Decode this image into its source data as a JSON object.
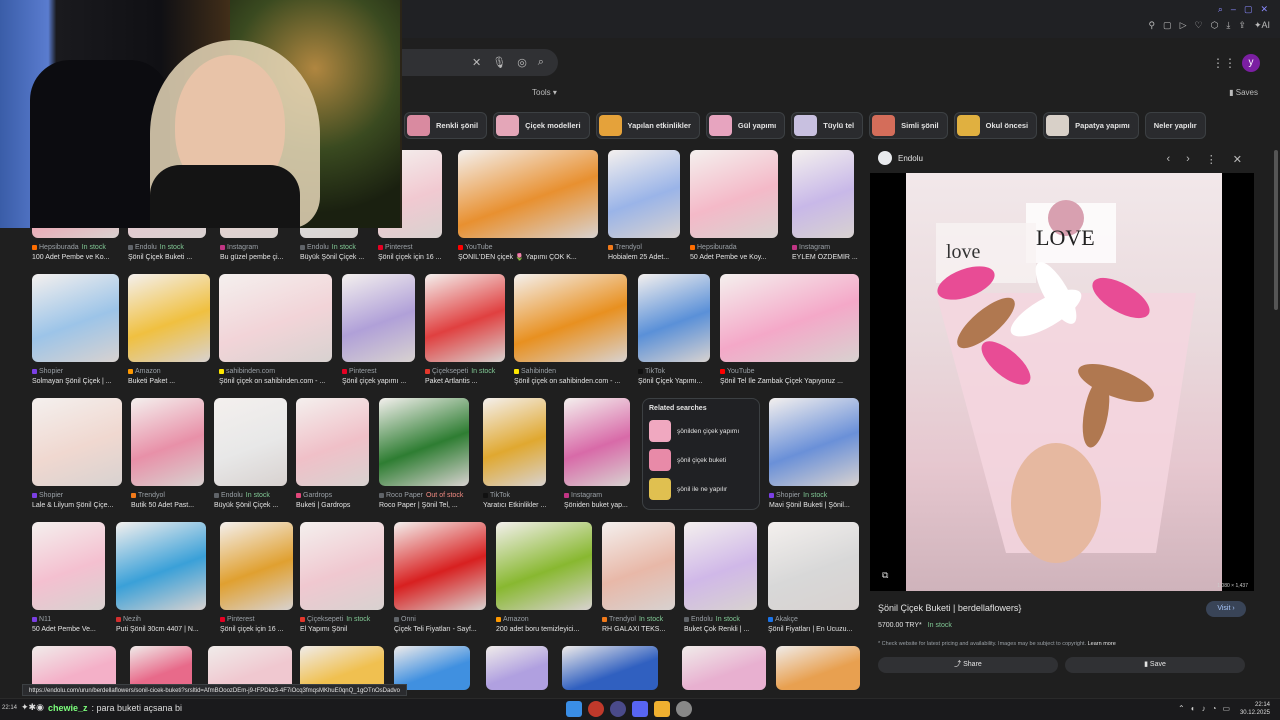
{
  "search": {
    "tools_label": "Tools",
    "saves_label": "Saves",
    "profile_initial": "y"
  },
  "chips": [
    {
      "label": "Renkli şönil",
      "color": "#d98aa0"
    },
    {
      "label": "Çiçek modelleri",
      "color": "#e4a6b8"
    },
    {
      "label": "Yapılan etkinlikler",
      "color": "#e5a23a"
    },
    {
      "label": "Gül yapımı",
      "color": "#e7a4bf"
    },
    {
      "label": "Tüylü tel",
      "color": "#c8c0e0"
    },
    {
      "label": "Simli şönil",
      "color": "#d46d5a"
    },
    {
      "label": "Okul öncesi",
      "color": "#e0b040"
    },
    {
      "label": "Papatya yapımı",
      "color": "#d8d0c8"
    },
    {
      "label": "Neler yapılır",
      "color": ""
    }
  ],
  "results": [
    {
      "src": "Hepsiburada",
      "stock": "In stock",
      "title": "100 Adet Pembe ve Ko...",
      "color": "#f0a0b0",
      "dot": "#ff6d00"
    },
    {
      "src": "Endolu",
      "stock": "In stock",
      "title": "Şönil Çiçek Buketi ...",
      "color": "#e6c7cf",
      "dot": "#5f6368"
    },
    {
      "src": "Instagram",
      "stock": "",
      "title": "Bu güzel pembe çi...",
      "color": "#e9d2cf",
      "dot": "#c13584"
    },
    {
      "src": "Endolu",
      "stock": "In stock",
      "title": "Büyük Şönil Çiçek ...",
      "color": "#ddd",
      "dot": "#5f6368"
    },
    {
      "src": "Pinterest",
      "stock": "",
      "title": "Şönil çiçek için 16 ...",
      "color": "#f1c9d1",
      "dot": "#e60023"
    },
    {
      "src": "YouTube",
      "stock": "",
      "title": "ŞÖNİL'DEN çiçek 🌷 Yapımı ÇOK K...",
      "color": "#e89030",
      "dot": "#ff0000"
    },
    {
      "src": "Trendyol",
      "stock": "",
      "title": "Hobialem 25 Adet...",
      "color": "#9ab4e8",
      "dot": "#f27a1a"
    },
    {
      "src": "Hepsiburada",
      "stock": "",
      "title": "50 Adet Pembe ve Koy...",
      "color": "#f4b9c8",
      "dot": "#ff6d00"
    },
    {
      "src": "Instagram",
      "stock": "",
      "title": "EYLEM ÖZDEMİR ...",
      "color": "#c8b8e8",
      "dot": "#c13584"
    },
    {
      "src": "Shopier",
      "stock": "",
      "title": "Solmayan Şönil Çiçek | ...",
      "color": "#9cc4e8",
      "dot": "#7b3fe4"
    },
    {
      "src": "Amazon",
      "stock": "",
      "title": "Buketi Paket ...",
      "color": "#f0c040",
      "dot": "#ff9900"
    },
    {
      "src": "sahibinden.com",
      "stock": "",
      "title": "Şönil çiçek on sahibinden.com - ...",
      "color": "#f2d4d8",
      "dot": "#ffe800"
    },
    {
      "src": "Pinterest",
      "stock": "",
      "title": "Şönil çiçek yapımı ...",
      "color": "#b0a0d8",
      "dot": "#e60023"
    },
    {
      "src": "Çiçeksepeti",
      "stock": "In stock",
      "title": "Paket Artlantis ...",
      "color": "#e04040",
      "dot": "#e4372b"
    },
    {
      "src": "Sahibinden",
      "stock": "",
      "title": "Şönil çiçek on sahibinden.com - ...",
      "color": "#e89020",
      "dot": "#ffe800"
    },
    {
      "src": "TikTok",
      "stock": "",
      "title": "Şönil Çiçek Yapımı...",
      "color": "#5a90d8",
      "dot": "#111"
    },
    {
      "src": "YouTube",
      "stock": "",
      "title": "Şönil Tel İle Zambak Çiçek Yapıyoruz ...",
      "color": "#f4a8c8",
      "dot": "#ff0000"
    },
    {
      "src": "Shopier",
      "stock": "",
      "title": "Lale & Lilyum Şönil Çiçe...",
      "color": "#f0d8d0",
      "dot": "#7b3fe4"
    },
    {
      "src": "Trendyol",
      "stock": "",
      "title": "Butik 50 Adet Past...",
      "color": "#e890a8",
      "dot": "#f27a1a"
    },
    {
      "src": "Endolu",
      "stock": "In stock",
      "title": "Büyük Şönil Çiçek ...",
      "color": "#e8e8e8",
      "dot": "#5f6368"
    },
    {
      "src": "Gardrops",
      "stock": "",
      "title": "Buketi | Gardrops",
      "color": "#f0c0c8",
      "dot": "#e2477b"
    },
    {
      "src": "Roco Paper",
      "stock": "Out of stock",
      "title": "Roco Paper | Şönil Tel, ...",
      "color": "#2e7d32",
      "dot": "#5f6368"
    },
    {
      "src": "TikTok",
      "stock": "",
      "title": "Yaratıcı Etkinlikler ...",
      "color": "#e0a830",
      "dot": "#111"
    },
    {
      "src": "Instagram",
      "stock": "",
      "title": "Şöniden buket yap...",
      "color": "#d86aa8",
      "dot": "#c13584"
    },
    {
      "src": "Shopier",
      "stock": "In stock",
      "title": "Mavi Şönil Buketi | Şönil...",
      "color": "#6a90d8",
      "dot": "#7b3fe4"
    },
    {
      "src": "N11",
      "stock": "",
      "title": "50 Adet Pembe Ve...",
      "color": "#f4c0d0",
      "dot": "#7b3fe4"
    },
    {
      "src": "Nezih",
      "stock": "",
      "title": "Puti Şönil 30cm 4407 | N...",
      "color": "#3aa0d8",
      "dot": "#d32f2f"
    },
    {
      "src": "Pinterest",
      "stock": "",
      "title": "Şönil çiçek için 16 ...",
      "color": "#e0a030",
      "dot": "#e60023"
    },
    {
      "src": "Çiçeksepeti",
      "stock": "In stock",
      "title": "El Yapımı Şönil",
      "color": "#f0c8d0",
      "dot": "#e4372b"
    },
    {
      "src": "Onni",
      "stock": "",
      "title": "Çiçek Teli Fiyatları - Sayf...",
      "color": "#d82020",
      "dot": "#5f6368"
    },
    {
      "src": "Amazon",
      "stock": "",
      "title": "200 adet boru temizleyici...",
      "color": "#88b830",
      "dot": "#ff9900"
    },
    {
      "src": "Trendyol",
      "stock": "In stock",
      "title": "RH GALAXİ TEKS...",
      "color": "#e8b8a8",
      "dot": "#f27a1a"
    },
    {
      "src": "Endolu",
      "stock": "In stock",
      "title": "Buket Çok Renkli | ...",
      "color": "#d0b8e8",
      "dot": "#5f6368"
    },
    {
      "src": "Akakçe",
      "stock": "",
      "title": "Şönil Fiyatları | En Ucuzu...",
      "color": "#d8d8d8",
      "dot": "#1a73e8"
    }
  ],
  "bottom_row_colors": [
    "#f4b0c8",
    "#e86a8a",
    "#f0c8d0",
    "#f0c050",
    "#4090e0",
    "#b0a0e0",
    "#3060c0",
    "#e8b0d0",
    "#e8a050"
  ],
  "related": {
    "heading": "Related searches",
    "items": [
      {
        "label": "şönilden çiçek yapımı",
        "color": "#f0a8c0"
      },
      {
        "label": "şönil çiçek buketi",
        "color": "#e88aa8"
      },
      {
        "label": "şönil ile ne yapılır",
        "color": "#e0c050"
      }
    ]
  },
  "panel": {
    "source": "Endolu",
    "title": "Şönil Çiçek Buketi | berdellaflowers}",
    "visit": "Visit ›",
    "price": "5700.00 TRY*",
    "stock": "In stock",
    "note": "* Check website for latest pricing and availability. Images may be subject to copyright.",
    "learn_more": "Learn more",
    "share": "Share",
    "save": "Save",
    "size": "1,080 × 1,437"
  },
  "status_url": "https://endolu.com/urun/berdellaflowers/sonil-cicek-buketi?srsltid=AfmBOoozDEm-j9-tFPDkz3-4F7iOcq3fmqsMKhuE0qnQ_1gOTnOsDadvo",
  "chat": {
    "time": "22:14",
    "user": "chewie_z",
    "message": ": para buketi açsana bi"
  },
  "clock": {
    "time": "22:14",
    "date": "30.12.2025"
  }
}
